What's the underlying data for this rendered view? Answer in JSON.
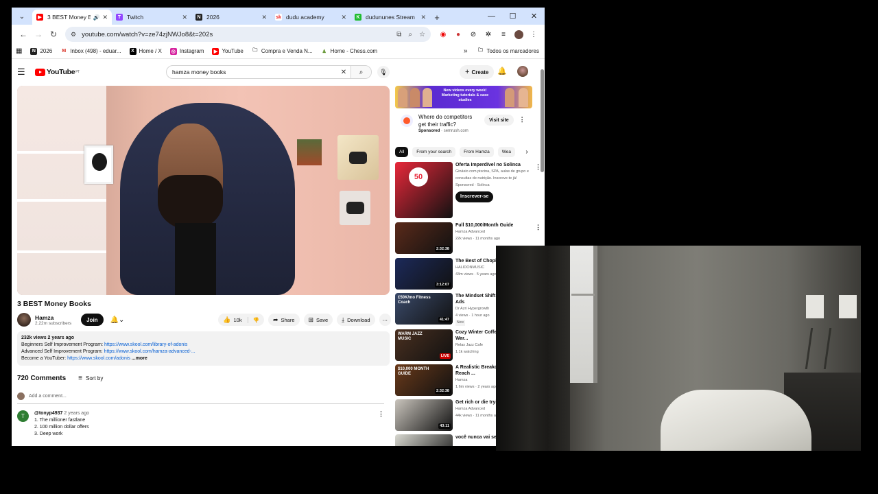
{
  "browser": {
    "tabs": [
      {
        "title": "3 BEST Money Bo",
        "favicon": "youtube-icon",
        "color": "#ff0000",
        "glyph": "▶",
        "active": true,
        "audio": true
      },
      {
        "title": "Twitch",
        "favicon": "twitch-icon",
        "color": "#9146ff",
        "glyph": "T",
        "active": false
      },
      {
        "title": "2026",
        "favicon": "notion-icon",
        "color": "#222222",
        "glyph": "N",
        "active": false
      },
      {
        "title": "dudu academy",
        "favicon": "skool-icon",
        "color": "#ffffff",
        "glyph": "sk",
        "active": false
      },
      {
        "title": "dudununes Stream",
        "favicon": "kick-icon",
        "color": "#1fbc2f",
        "glyph": "K",
        "active": false
      }
    ],
    "url": "youtube.com/watch?v=ze74zjNWJo8&t=202s",
    "bookmarks": [
      {
        "label": "2026",
        "icon": "notion-icon"
      },
      {
        "label": "Inbox (498) - eduar...",
        "icon": "gmail-icon"
      },
      {
        "label": "Home / X",
        "icon": "x-icon"
      },
      {
        "label": "Instagram",
        "icon": "instagram-icon"
      },
      {
        "label": "YouTube",
        "icon": "youtube-icon"
      },
      {
        "label": "Compra e Venda N...",
        "icon": "folder-icon"
      },
      {
        "label": "Home - Chess.com",
        "icon": "chess-icon"
      }
    ],
    "all_bookmarks": "Todos os marcadores"
  },
  "youtube": {
    "logo": "YouTube",
    "region": "PT",
    "search_query": "hamza money books",
    "create_label": "Create",
    "video": {
      "title": "3 BEST Money Books",
      "channel": "Hamza",
      "subscribers": "2.22m subscribers",
      "join": "Join",
      "likes": "10k",
      "share": "Share",
      "save": "Save",
      "download": "Download",
      "description": {
        "meta": "232k views  2 years ago",
        "line1_text": "Beginners Self Improvement Program: ",
        "line1_link": "https://www.skool.com/library-of-adonis",
        "line2_text": "Advanced Self Improvement Program: ",
        "line2_link": "https://www.skool.com/hamza-advanced-...",
        "line3_text": "Become a YouTuber: ",
        "line3_link": "https://www.skool.com/adonis",
        "more": "...more"
      }
    },
    "comments": {
      "count": "720 Comments",
      "sort": "Sort by",
      "add_placeholder": "Add a comment...",
      "first": {
        "avatar_letter": "T",
        "user": "@tonyp4937",
        "time": "2 years ago",
        "lines": [
          "1. The millioner fastlane",
          "2. 100 million dollar offers",
          "3. Deep work"
        ]
      }
    },
    "ad": {
      "banner": "New videos every week! Marketing tutorials & case studies",
      "title": "Where do competitors get their traffic?",
      "sponsored": "Sponsored",
      "domain": "semrush.com",
      "visit": "Visit site"
    },
    "chips": [
      "All",
      "From your search",
      "From Hamza",
      "Wea"
    ],
    "recommendations": [
      {
        "title": "Oferta Imperdível no Solinca",
        "line2": "Ginásio com piscina, SPA, aulas de grupo e consultas de nutrição. Inscreve-te já!",
        "meta": "Sponsored · Solinca",
        "button": "Inscrever-se",
        "badge": "50",
        "thumb": "#e8283a"
      },
      {
        "title": "Full $10,000/Month Guide",
        "line2": "Hamza Advanced",
        "meta": "22k views · 11 months ago",
        "duration": "2:32:38",
        "thumb": "#5a2a1a"
      },
      {
        "title": "The Best of Chopin",
        "line2": "HALIDONMUSIC",
        "meta": "43m views · 5 years ago",
        "duration": "3:12:07",
        "thumb": "#1c2a5a"
      },
      {
        "title": "The Mindset Shift B... Profitable Ads",
        "line2": "Dr Azri Hypergrowth",
        "meta": "4 views · 1 hour ago",
        "badge_new": "New",
        "duration": "41:47",
        "overlay": "£50K/mo Fitness Coach",
        "thumb": "#3a4a6a"
      },
      {
        "title": "Cozy Winter Coffee Ambience with War...",
        "line2": "Relax Jazz Cafe",
        "meta": "1.1k watching",
        "duration": "LIVE",
        "overlay": "WARM JAZZ MUSIC",
        "thumb": "#4a3020"
      },
      {
        "title": "A Realistic Breakdo... It Takes To Reach ...",
        "line2": "Hamza",
        "meta": "1.6m views · 2 years ago",
        "duration": "2:32:38",
        "overlay": "$10,000 MONTH GUIDE",
        "thumb": "#6a3a1a"
      },
      {
        "title": "Get rich or die tryin...",
        "line2": "Hamza Advanced",
        "meta": "44k views · 11 months ago",
        "duration": "43:11",
        "thumb": "#c9c4bc"
      },
      {
        "title": "você nunca vai ser... sozinho",
        "line2": "",
        "meta": "",
        "thumb": "#d8d8d0"
      }
    ]
  }
}
